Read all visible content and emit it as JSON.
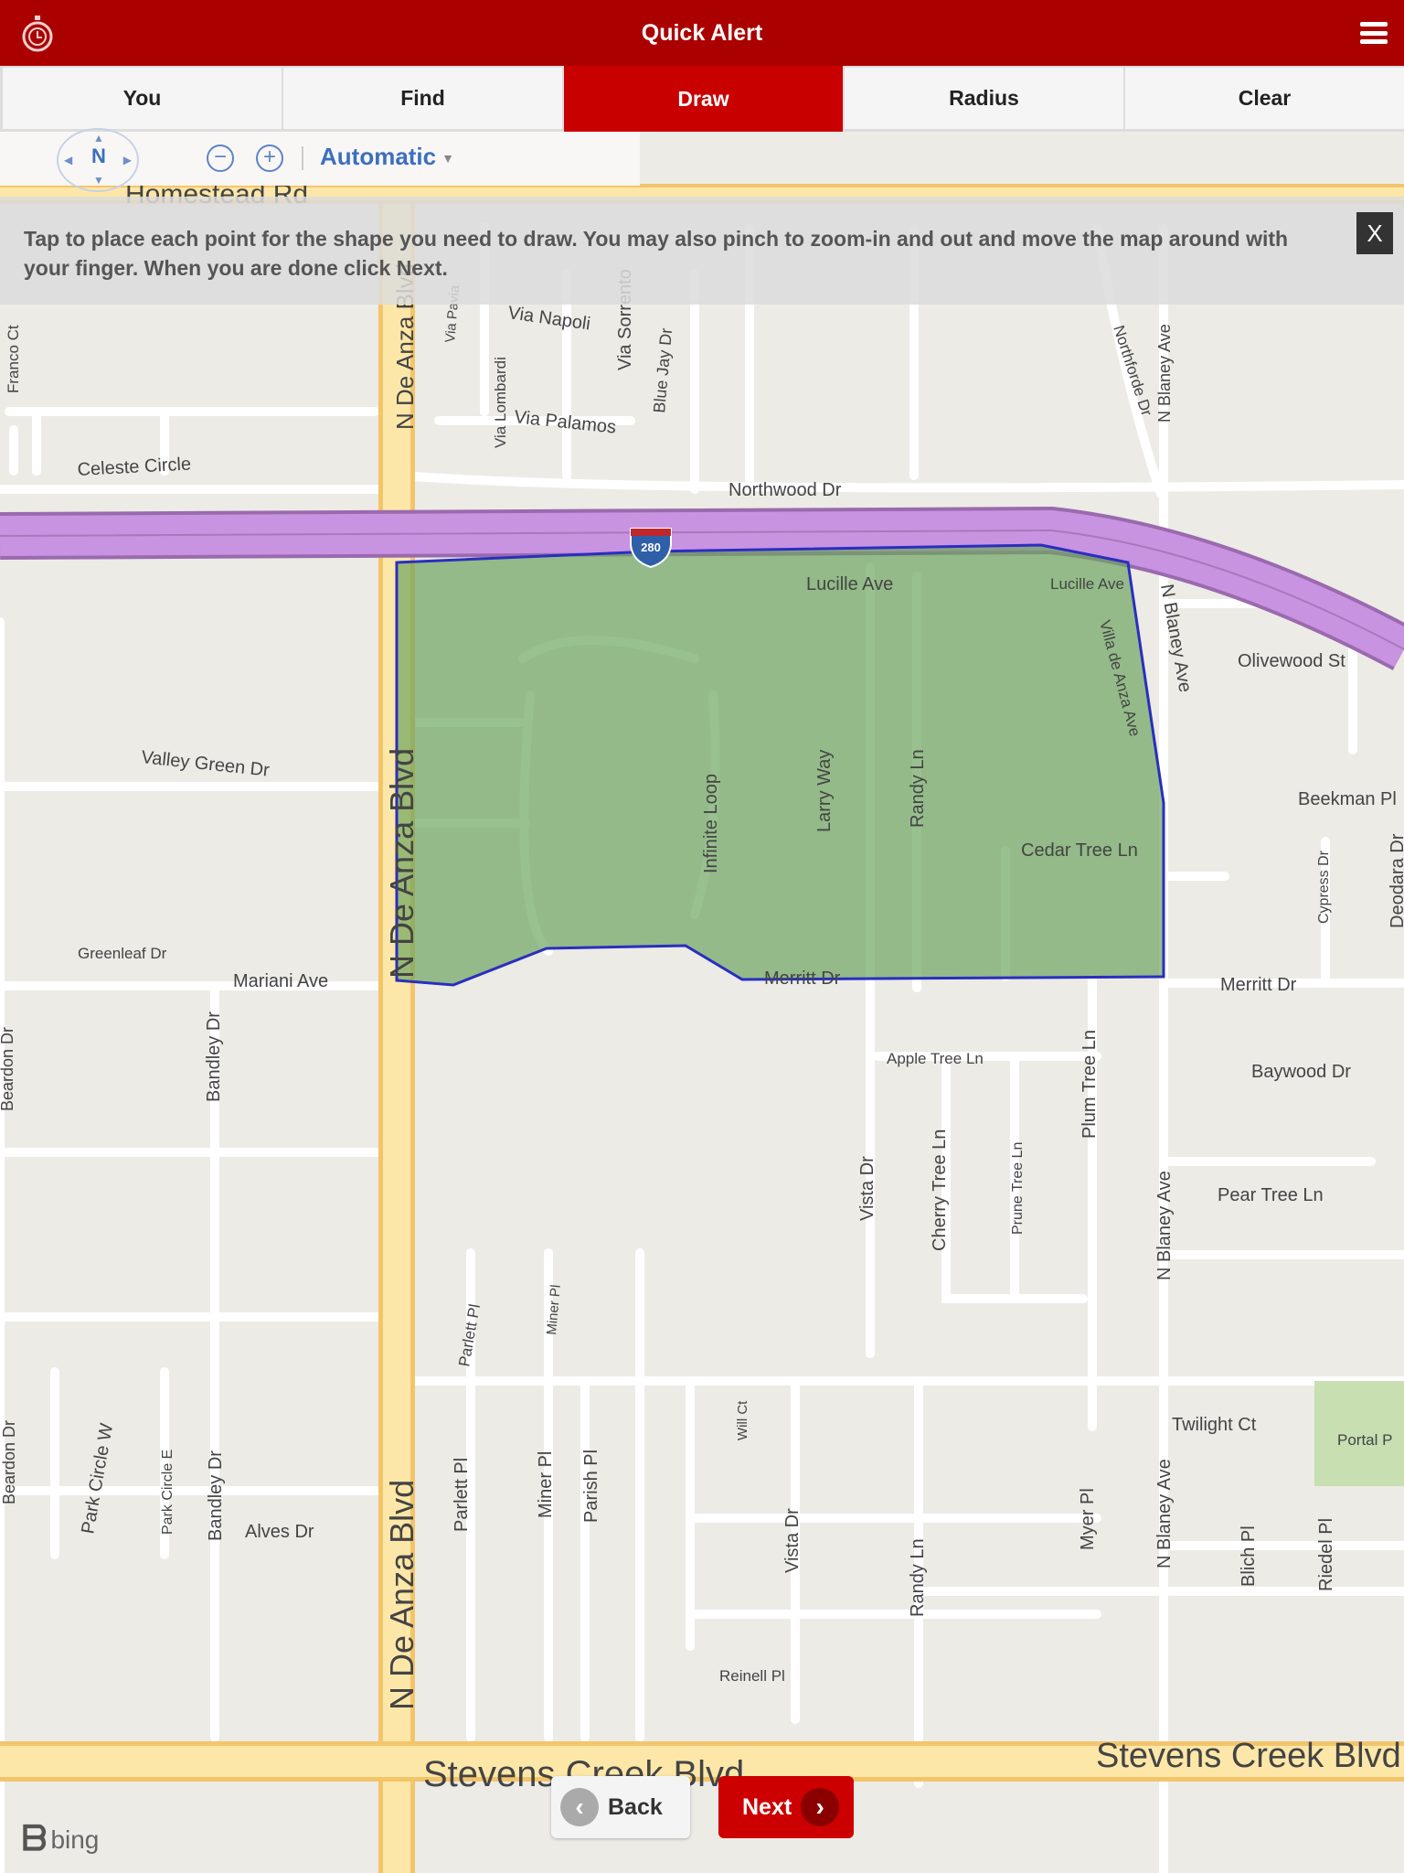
{
  "header": {
    "title": "Quick Alert",
    "logo_icon": "stopwatch-icon",
    "menu_icon": "hamburger-menu-icon"
  },
  "tabs": [
    {
      "label": "You"
    },
    {
      "label": "Find"
    },
    {
      "label": "Draw",
      "active": true
    },
    {
      "label": "Radius"
    },
    {
      "label": "Clear"
    }
  ],
  "map_controls": {
    "compass_label": "N",
    "zoom_out": "−",
    "zoom_in": "+",
    "map_style": "Automatic"
  },
  "instructions": {
    "text": "Tap to place each point for the shape you need to draw. You may also pinch to zoom-in and out and move the map around with your finger. When you are done click Next.",
    "close_label": "X"
  },
  "map": {
    "shield": "280",
    "polygon_fill": "#8db585",
    "polygon_stroke": "#2a2ec0",
    "freeway_color": "#c893e0",
    "arterial_color": "#fbe3a0",
    "labels": [
      "Homestead Rd",
      "N De Anza Blvd",
      "Via Napoli",
      "Via Lombardi",
      "Via Palamos",
      "Celeste Circle",
      "Northwood Dr",
      "Via Sorrento",
      "Northforde Dr",
      "N Blaney Ave",
      "Lucille Ave",
      "Lucille Ave",
      "Villa de Anza Ave",
      "N Blaney Ave",
      "Olivewood St",
      "Valley Green Dr",
      "N De Anza Blvd",
      "Infinite Loop",
      "Larry Way",
      "Randy Ln",
      "Beekman Pl",
      "Cedar Tree Ln",
      "Cypress Dr",
      "Deodara Dr",
      "Greenleaf Dr",
      "Mariani Ave",
      "Merritt Dr",
      "Merritt Dr",
      "Beardon Dr",
      "Bandley Dr",
      "Apple Tree Ln",
      "Plum Tree Ln",
      "Baywood Dr",
      "Cherry Tree Ln",
      "Prune Tree Ln",
      "Vista Dr",
      "N Blaney Ave",
      "Pear Tree Ln",
      "Parlett Pl",
      "Miner Pl",
      "Will Ct",
      "Twilight Ct",
      "Portal P",
      "Beardon Dr",
      "Park Circle W",
      "Park Circle E",
      "Bandley Dr",
      "N De Anza Blvd",
      "Parlett Pl",
      "Miner Pl",
      "Parish Pl",
      "Alves Dr",
      "Vista Dr",
      "Randy Ln",
      "Myer Pl",
      "N Blaney Ave",
      "Blich Pl",
      "Riedel Pl",
      "Reinell Pl",
      "Stevens Creek Blvd",
      "Stevens Creek Blvd",
      "Franco Ct",
      "Via Pavia",
      "Blue Jay Dr"
    ]
  },
  "footer": {
    "back_label": "Back",
    "next_label": "Next",
    "attribution": "bing"
  }
}
